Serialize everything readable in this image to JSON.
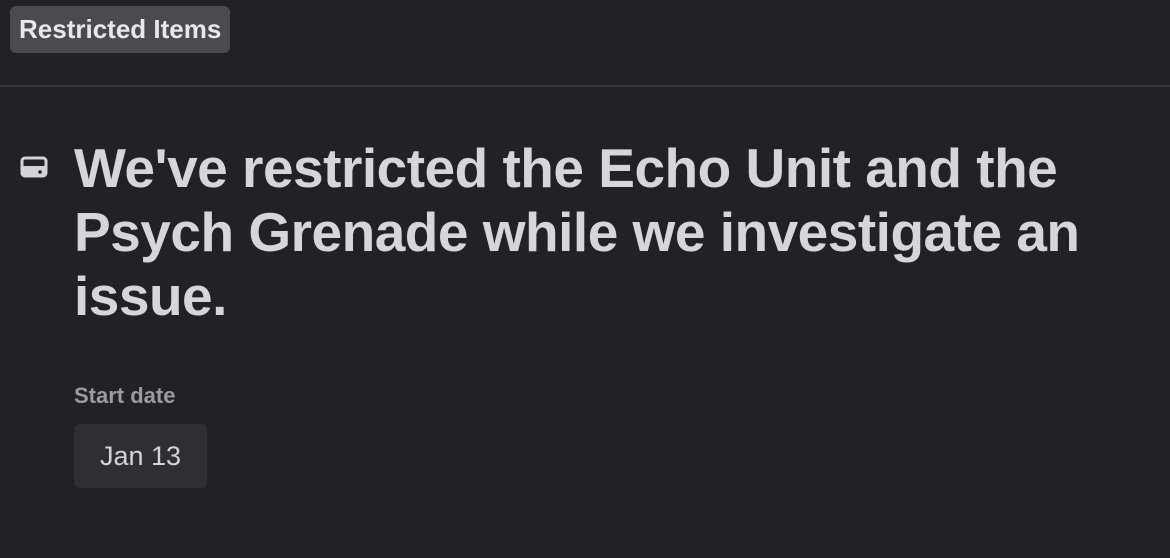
{
  "header": {
    "tag_label": "Restricted Items"
  },
  "notice": {
    "icon": "hard-drive-icon",
    "title": "We've restricted the Echo Unit and the Psych Grenade while we investigate an issue.",
    "start_date_label": "Start date",
    "start_date_value": "Jan 13"
  },
  "colors": {
    "background": "#222226",
    "tag_background": "#4a4a50",
    "title_text": "#d6d6da",
    "muted_text": "#9b9ba1",
    "chip_background": "#2e2e33"
  }
}
